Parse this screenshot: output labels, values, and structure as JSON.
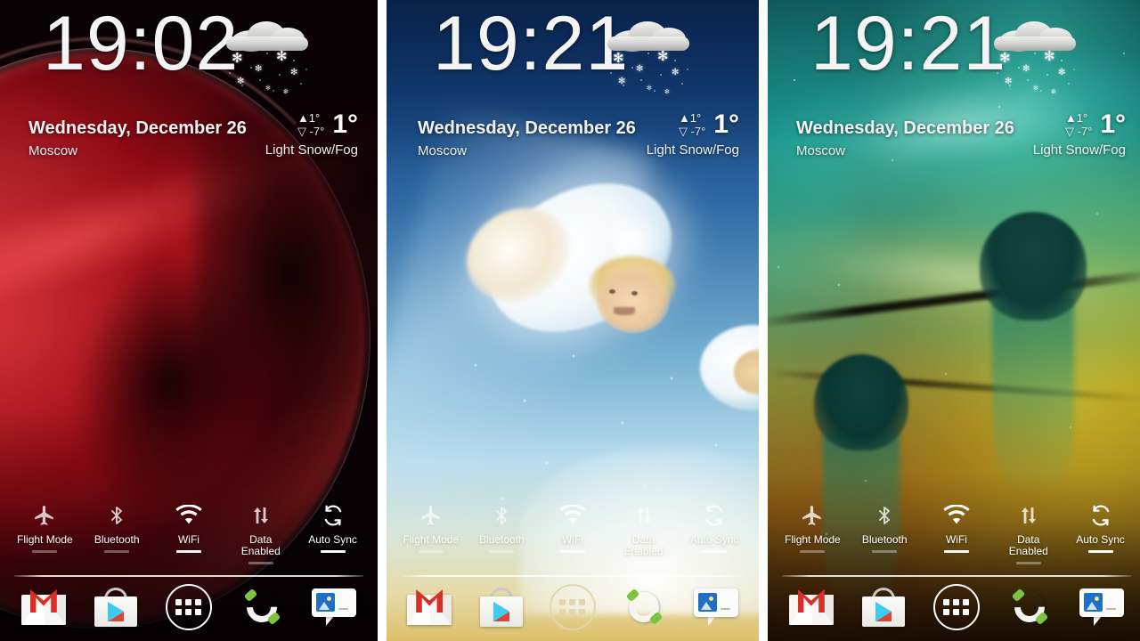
{
  "screens": [
    {
      "id": "screen-red",
      "wallpaper_name": "red-planet-eclipse-wallpaper",
      "clock": "19:02",
      "date": "Wednesday, December 26",
      "city": "Moscow",
      "weather": {
        "icon": "snow-cloud-icon",
        "high": "▲1°",
        "low": "▽ -7°",
        "current": "1°",
        "condition": "Light Snow/Fog"
      }
    },
    {
      "id": "screen-blue",
      "wallpaper_name": "cloud-cherubs-wallpaper",
      "clock": "19:21",
      "date": "Wednesday, December 26",
      "city": "Moscow",
      "weather": {
        "icon": "snow-cloud-icon",
        "high": "▲1°",
        "low": "▽ -7°",
        "current": "1°",
        "condition": "Light Snow/Fog"
      }
    },
    {
      "id": "screen-nebula",
      "wallpaper_name": "teal-gold-nebula-wallpaper",
      "clock": "19:21",
      "date": "Wednesday, December 26",
      "city": "Moscow",
      "weather": {
        "icon": "snow-cloud-icon",
        "high": "▲1°",
        "low": "▽ -7°",
        "current": "1°",
        "condition": "Light Snow/Fog"
      }
    }
  ],
  "toggles": [
    {
      "label": "Flight Mode",
      "icon": "airplane-icon",
      "state": "off"
    },
    {
      "label": "Bluetooth",
      "icon": "bluetooth-icon",
      "state": "off"
    },
    {
      "label": "WiFi",
      "icon": "wifi-icon",
      "state": "on"
    },
    {
      "label": "Data\nEnabled",
      "icon": "data-sync-arrows-icon",
      "state": "off"
    },
    {
      "label": "Auto Sync",
      "icon": "auto-sync-icon",
      "state": "on"
    }
  ],
  "toggle_labels": {
    "flight_mode": "Flight Mode",
    "bluetooth": "Bluetooth",
    "wifi": "WiFi",
    "data_enabled_1": "Data",
    "data_enabled_2": "Enabled",
    "auto_sync": "Auto Sync"
  },
  "dock": [
    {
      "name": "gmail-icon",
      "label": "Gmail"
    },
    {
      "name": "play-store-icon",
      "label": "Play Store"
    },
    {
      "name": "app-drawer-icon",
      "label": "Apps"
    },
    {
      "name": "phone-icon",
      "label": "Phone"
    },
    {
      "name": "messaging-icon",
      "label": "Messaging"
    }
  ],
  "colors": {
    "text_primary": "#f4f4f4",
    "toggle_on": "#ffffff",
    "toggle_off": "rgba(255,255,255,0.35)",
    "gmail_red": "#d93025",
    "phone_green": "#7dc242",
    "drawer_tint_panel2": "#e3d6ae"
  }
}
